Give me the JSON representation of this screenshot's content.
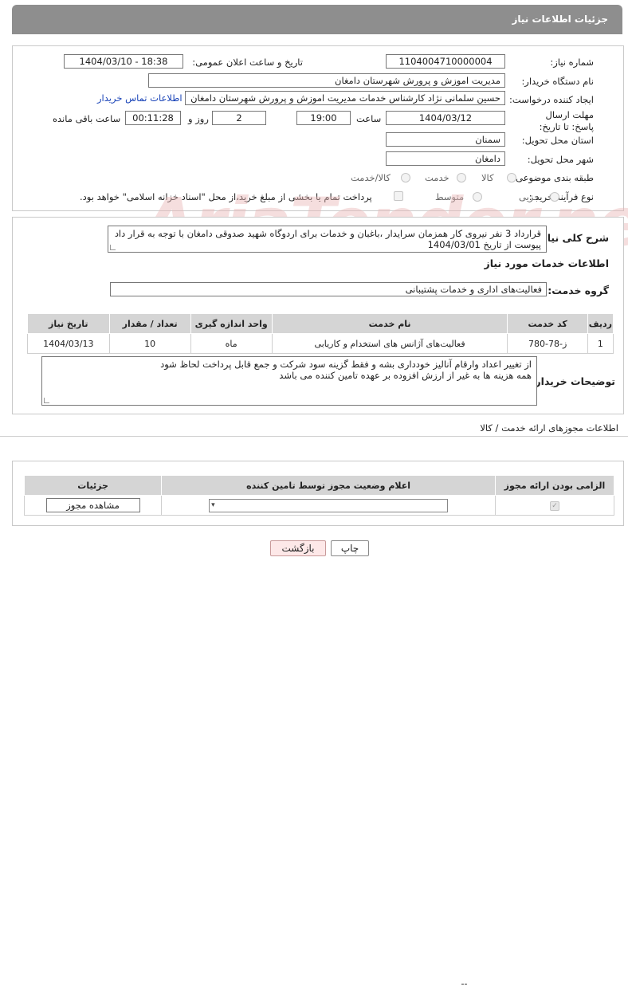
{
  "header": {
    "title": "جزئیات اطلاعات نیاز"
  },
  "form": {
    "need_number_label": "شماره نیاز:",
    "need_number": "1104004710000004",
    "announce_label": "تاریخ و ساعت اعلان عمومی:",
    "announce_value": "1404/03/10 - 18:38",
    "buyer_org_label": "نام دستگاه خریدار:",
    "buyer_org": "مدیریت اموزش و پرورش شهرستان دامغان",
    "requester_label": "ایجاد کننده درخواست:",
    "requester": "حسین سلمانی نژاد کارشناس خدمات مدیریت اموزش و پرورش شهرستان دامغان",
    "contact_link": "اطلاعات تماس خریدار",
    "deadline_label": "مهلت ارسال پاسخ: تا تاریخ:",
    "deadline_date": "1404/03/12",
    "time_label": "ساعت",
    "deadline_time": "19:00",
    "days_value": "2",
    "days_label": "روز و",
    "remaining_time": "00:11:28",
    "remaining_label": "ساعت باقی مانده",
    "province_label": "استان محل تحویل:",
    "province": "سمنان",
    "city_label": "شهر محل تحویل:",
    "city": "دامغان",
    "category_label": "طبقه بندی موضوعی:",
    "category_options": [
      "کالا",
      "خدمت",
      "کالا/خدمت"
    ],
    "process_label": "نوع فرآیند خرید :",
    "process_options": [
      "جزیی",
      "متوسط"
    ],
    "payment_note": "پرداخت تمام یا بخشی از مبلغ خرید،از محل \"اسناد خزانه اسلامی\" خواهد بود."
  },
  "summary": {
    "label": "شرح کلی نیاز:",
    "text": "قرارداد 3 نفر نیروی کار همزمان  سرایدار ،باغبان و خدمات برای اردوگاه شهید صدوقی دامغان با توجه به قرار داد پیوست از تاریخ 1404/03/01"
  },
  "services": {
    "section_title": "اطلاعات خدمات مورد نیاز",
    "group_label": "گروه خدمت:",
    "group_value": "فعالیت‌های اداری و خدمات پشتیبانی",
    "columns": [
      "ردیف",
      "کد خدمت",
      "نام خدمت",
      "واحد اندازه گیری",
      "تعداد / مقدار",
      "تاریخ نیاز"
    ],
    "rows": [
      [
        "1",
        "ز-78-780",
        "فعالیت‌های آژانس های استخدام و کاریابی",
        "ماه",
        "10",
        "1404/03/13"
      ]
    ]
  },
  "buyer_notes": {
    "label": "توضیحات خریدار:",
    "line1": "از تغییر اعداد وارقام آنالیز خودداری بشه و فقط گزینه سود شرکت و جمع قابل پرداخت لحاظ شود",
    "line2": "همه هزینه ها به غیر از ارزش افزوده بر عهده تامین کننده می باشد"
  },
  "permits": {
    "section_title": "اطلاعات مجوزهای ارائه خدمت / کالا",
    "columns": [
      "الزامی بودن ارائه مجوز",
      "اعلام وضعیت مجوز توسط تامین کننده",
      "جزئیات"
    ],
    "select_value": "--",
    "view_button": "مشاهده مجوز"
  },
  "buttons": {
    "print": "چاپ",
    "back": "بازگشت"
  },
  "watermark": "AriaTender.neT"
}
